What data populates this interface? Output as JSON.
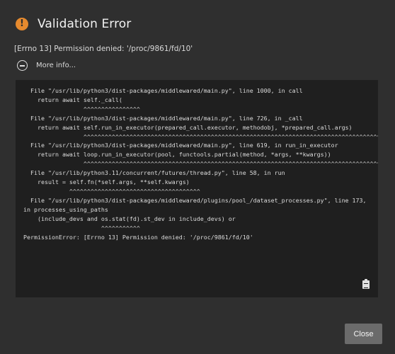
{
  "dialog": {
    "title": "Validation Error",
    "message": "[Errno 13] Permission denied: '/proc/9861/fd/10'",
    "more_info_label": "More info...",
    "icons": {
      "header": "warning-icon",
      "toggle": "collapse-minus-icon",
      "copy": "clipboard-icon"
    },
    "traceback": "  File \"/usr/lib/python3/dist-packages/middlewared/main.py\", line 1000, in call\n    return await self._call(\n                 ^^^^^^^^^^^^^^^^\n  File \"/usr/lib/python3/dist-packages/middlewared/main.py\", line 726, in _call\n    return await self.run_in_executor(prepared_call.executor, methodobj, *prepared_call.args)\n                 ^^^^^^^^^^^^^^^^^^^^^^^^^^^^^^^^^^^^^^^^^^^^^^^^^^^^^^^^^^^^^^^^^^^^^^^^^^^^^^^^^^^^^^^^^^^^^^^^^\n  File \"/usr/lib/python3/dist-packages/middlewared/main.py\", line 619, in run_in_executor\n    return await loop.run_in_executor(pool, functools.partial(method, *args, **kwargs))\n                 ^^^^^^^^^^^^^^^^^^^^^^^^^^^^^^^^^^^^^^^^^^^^^^^^^^^^^^^^^^^^^^^^^^^^^^^^^^^^^^^^^^^^^^^\n  File \"/usr/lib/python3.11/concurrent/futures/thread.py\", line 58, in run\n    result = self.fn(*self.args, **self.kwargs)\n             ^^^^^^^^^^^^^^^^^^^^^^^^^^^^^^^^^^^^^\n  File \"/usr/lib/python3/dist-packages/middlewared/plugins/pool_/dataset_processes.py\", line 173,\nin processes_using_paths\n    (include_devs and os.stat(fd).st_dev in include_devs) or\n                      ^^^^^^^^^^^\nPermissionError: [Errno 13] Permission denied: '/proc/9861/fd/10'",
    "close_label": "Close",
    "colors": {
      "background": "#2f2f2f",
      "trace_background": "#1f1f1f",
      "warning": "#e68a2e",
      "button": "#6b6b6b"
    }
  }
}
